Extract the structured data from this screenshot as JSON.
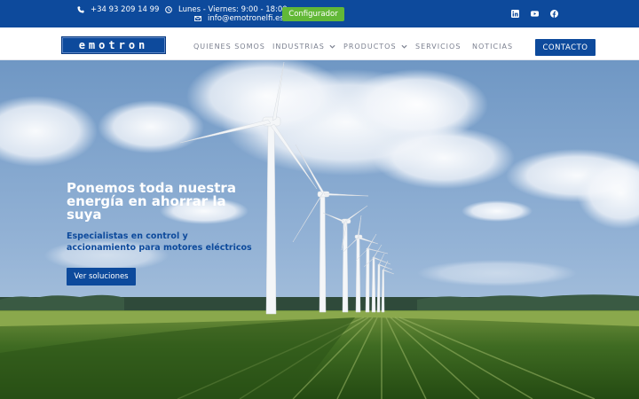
{
  "topbar": {
    "phone": "+34 93 209 14 99",
    "hours": "Lunes - Viernes: 9:00 - 18:00",
    "email": "info@emotronelfi.es",
    "configurator_label": "Configurador",
    "social_icons": [
      "linkedin-icon",
      "youtube-icon",
      "facebook-icon"
    ]
  },
  "nav": {
    "logo_text": "emotron",
    "items": [
      {
        "label": "QUIENES SOMOS",
        "dropdown": false
      },
      {
        "label": "INDUSTRIAS",
        "dropdown": true
      },
      {
        "label": "PRODUCTOS",
        "dropdown": true
      },
      {
        "label": "SERVICIOS",
        "dropdown": false
      },
      {
        "label": "NOTICIAS",
        "dropdown": false
      }
    ],
    "contact_label": "CONTACTO"
  },
  "hero": {
    "title": "Ponemos toda nuestra energía en ahorrar la suya",
    "subtitle": "Especialistas en control y accionamiento para motores eléctricos",
    "button_label": "Ver soluciones"
  },
  "colors": {
    "brand_blue": "#0d4a9c",
    "configurator_green": "#62b837",
    "nav_text": "#7c8190"
  }
}
